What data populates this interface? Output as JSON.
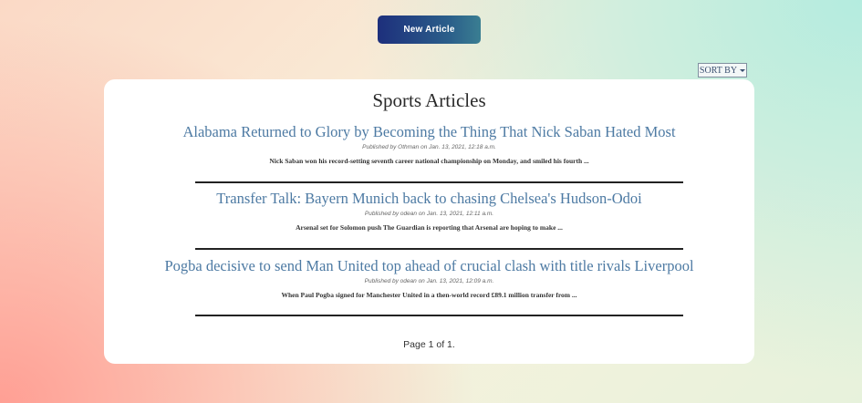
{
  "toolbar": {
    "new_article_label": "New Article",
    "sort_label": "SORT BY"
  },
  "main": {
    "title": "Sports Articles",
    "articles": [
      {
        "title": "Alabama Returned to Glory by Becoming the Thing That Nick Saban Hated Most",
        "meta": "Published by Othman on Jan. 13, 2021, 12:18 a.m.",
        "summary": "Nick Saban won his record-setting seventh career national championship on Monday, and smiled his fourth ..."
      },
      {
        "title": "Transfer Talk: Bayern Munich back to chasing Chelsea's Hudson-Odoi",
        "meta": "Published by odean on Jan. 13, 2021, 12:11 a.m.",
        "summary": "Arsenal set for Solomon push The Guardian is reporting that Arsenal are hoping to make ..."
      },
      {
        "title": "Pogba decisive to send Man United top ahead of crucial clash with title rivals Liverpool",
        "meta": "Published by odean on Jan. 13, 2021, 12:09 a.m.",
        "summary": "When Paul Pogba signed for Manchester United in a then-world record £89.1 million transfer from ..."
      }
    ],
    "pagination": "Page 1 of 1."
  }
}
